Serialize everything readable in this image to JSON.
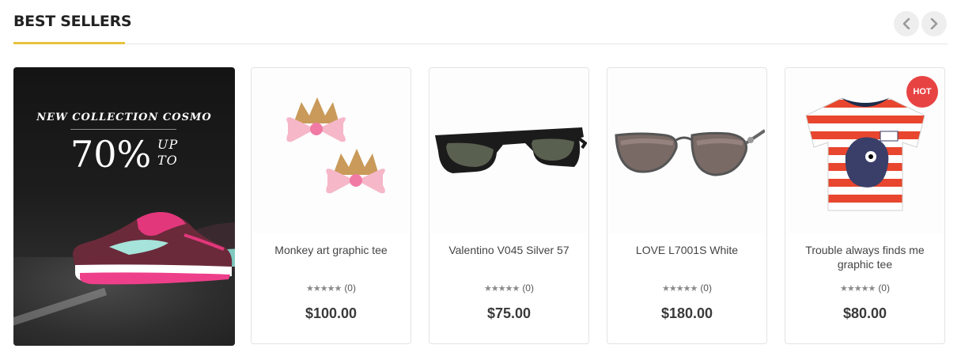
{
  "section": {
    "title": "BEST SELLERS",
    "accent_color": "#e8c33f",
    "nav": {
      "prev_icon": "chevron-left-icon",
      "next_icon": "chevron-right-icon"
    }
  },
  "banner": {
    "caption": "NEW COLLECTION COSMO",
    "big_text": "70%",
    "small_text": "UP TO",
    "image": "pink-running-shoe-image"
  },
  "products": [
    {
      "name": "Monkey art graphic tee",
      "rating_count": "(0)",
      "price": "$100.00",
      "image": "crown-hair-clips-image",
      "badge": ""
    },
    {
      "name": "Valentino V045 Silver 57",
      "rating_count": "(0)",
      "price": "$75.00",
      "image": "black-sunglasses-image",
      "badge": ""
    },
    {
      "name": "LOVE L7001S White",
      "rating_count": "(0)",
      "price": "$180.00",
      "image": "aviator-sunglasses-image",
      "badge": ""
    },
    {
      "name": "Trouble always finds me graphic tee",
      "rating_count": "(0)",
      "price": "$80.00",
      "image": "striped-kids-tee-image",
      "badge": "HOT"
    }
  ],
  "badge_color": "#e84343"
}
